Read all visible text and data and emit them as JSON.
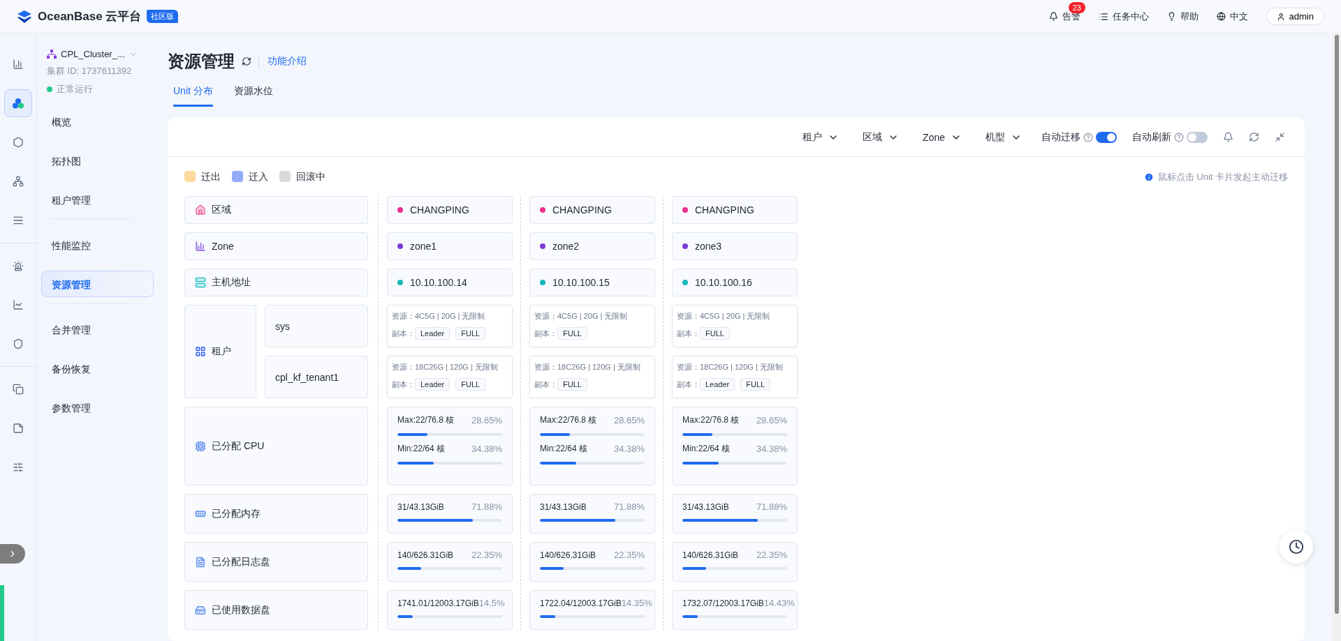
{
  "topbar": {
    "brand": "OceanBase 云平台",
    "edition": "社区版",
    "alarm": {
      "label": "告警",
      "count": "23"
    },
    "tasks": "任务中心",
    "help": "帮助",
    "language": "中文",
    "user": "admin"
  },
  "rail": [
    {
      "kind": "overview",
      "selected": false
    },
    {
      "kind": "cluster",
      "selected": true
    },
    {
      "kind": "tenant",
      "selected": false
    },
    {
      "kind": "topology",
      "selected": false
    },
    {
      "kind": "list",
      "selected": false
    },
    {
      "kind": "alarm",
      "selected": false
    },
    {
      "kind": "monitor",
      "selected": false
    },
    {
      "kind": "security",
      "selected": false
    },
    {
      "kind": "copy",
      "selected": false
    },
    {
      "kind": "notes",
      "selected": false
    },
    {
      "kind": "settings",
      "selected": false
    }
  ],
  "cluster": {
    "name": "CPL_Cluster_...",
    "id": "集群 ID: 1737611392",
    "status": "正常运行"
  },
  "sidebar": {
    "items": [
      {
        "label": "概览",
        "selected": false,
        "divider_after": false
      },
      {
        "label": "拓扑图",
        "selected": false,
        "divider_after": false
      },
      {
        "label": "租户管理",
        "selected": false,
        "divider_after": true
      },
      {
        "label": "性能监控",
        "selected": false,
        "divider_after": false
      },
      {
        "label": "资源管理",
        "selected": true,
        "divider_after": true
      },
      {
        "label": "合并管理",
        "selected": false,
        "divider_after": false
      },
      {
        "label": "备份恢复",
        "selected": false,
        "divider_after": false
      },
      {
        "label": "参数管理",
        "selected": false,
        "divider_after": false
      }
    ]
  },
  "page": {
    "title": "资源管理",
    "intro_link": "功能介绍"
  },
  "tabs": [
    {
      "label": "Unit 分布",
      "selected": true
    },
    {
      "label": "资源水位",
      "selected": false
    }
  ],
  "filters": [
    "租户",
    "区域",
    "Zone",
    "机型"
  ],
  "toggles": [
    {
      "label": "自动迁移",
      "on": true
    },
    {
      "label": "自动刷新",
      "on": false
    }
  ],
  "legend": [
    {
      "label": "迁出",
      "color": "#ffd89e"
    },
    {
      "label": "迁入",
      "color": "#94adfb"
    },
    {
      "label": "回滚中",
      "color": "#d9d9d9"
    }
  ],
  "hint": "鼠标点击 Unit 卡片发起主动迁移",
  "row_labels": {
    "region": "区域",
    "zone": "Zone",
    "host": "主机地址",
    "tenant": "租户",
    "cpu": "已分配 CPU",
    "memory": "已分配内存",
    "log_disk": "已分配日志盘",
    "data_disk": "已使用数据盘"
  },
  "tenants": [
    "sys",
    "cpl_kf_tenant1"
  ],
  "nodes": [
    {
      "region": "CHANGPING",
      "zone": "zone1",
      "host": "10.10.100.14",
      "units": [
        {
          "resource": "资源：4C5G | 20G | 无限制",
          "replica_label": "副本：",
          "replicas": [
            "Leader",
            "FULL"
          ]
        },
        {
          "resource": "资源：18C26G | 120G | 无限制",
          "replica_label": "副本：",
          "replicas": [
            "Leader",
            "FULL"
          ]
        }
      ],
      "cpu": [
        {
          "text": "Max:22/76.8 核",
          "percent": "28.65%",
          "level": 0.2865
        },
        {
          "text": "Min:22/64 核",
          "percent": "34.38%",
          "level": 0.3438
        }
      ],
      "memory": {
        "text": "31/43.13GiB",
        "percent": "71.88%",
        "level": 0.7188
      },
      "log_disk": {
        "text": "140/626.31GiB",
        "percent": "22.35%",
        "level": 0.2235
      },
      "data_disk": {
        "text": "1741.01/12003.17GiB",
        "percent": "14.5%",
        "level": 0.145
      }
    },
    {
      "region": "CHANGPING",
      "zone": "zone2",
      "host": "10.10.100.15",
      "units": [
        {
          "resource": "资源：4C5G | 20G | 无限制",
          "replica_label": "副本：",
          "replicas": [
            "FULL"
          ]
        },
        {
          "resource": "资源：18C26G | 120G | 无限制",
          "replica_label": "副本：",
          "replicas": [
            "FULL"
          ]
        }
      ],
      "cpu": [
        {
          "text": "Max:22/76.8 核",
          "percent": "28.65%",
          "level": 0.2865
        },
        {
          "text": "Min:22/64 核",
          "percent": "34.38%",
          "level": 0.3438
        }
      ],
      "memory": {
        "text": "31/43.13GiB",
        "percent": "71.88%",
        "level": 0.7188
      },
      "log_disk": {
        "text": "140/626.31GiB",
        "percent": "22.35%",
        "level": 0.2235
      },
      "data_disk": {
        "text": "1722.04/12003.17GiB",
        "percent": "14.35%",
        "level": 0.1435
      }
    },
    {
      "region": "CHANGPING",
      "zone": "zone3",
      "host": "10.10.100.16",
      "units": [
        {
          "resource": "资源：4C5G | 20G | 无限制",
          "replica_label": "副本：",
          "replicas": [
            "FULL"
          ]
        },
        {
          "resource": "资源：18C26G | 120G | 无限制",
          "replica_label": "副本：",
          "replicas": [
            "Leader",
            "FULL"
          ]
        }
      ],
      "cpu": [
        {
          "text": "Max:22/76.8 核",
          "percent": "28.65%",
          "level": 0.2865
        },
        {
          "text": "Min:22/64 核",
          "percent": "34.38%",
          "level": 0.3438
        }
      ],
      "memory": {
        "text": "31/43.13GiB",
        "percent": "71.88%",
        "level": 0.7188
      },
      "log_disk": {
        "text": "140/626.31GiB",
        "percent": "22.35%",
        "level": 0.2235
      },
      "data_disk": {
        "text": "1732.07/12003.17GiB",
        "percent": "14.43%",
        "level": 0.1443
      }
    }
  ]
}
